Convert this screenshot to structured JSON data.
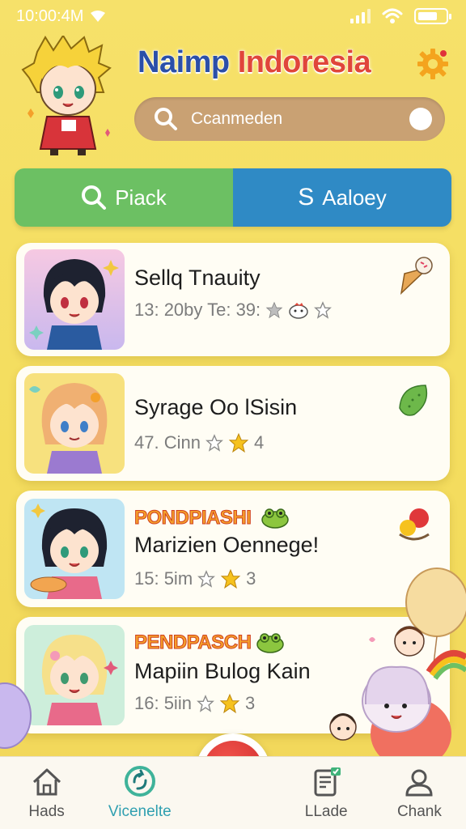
{
  "status_bar": {
    "time": "10:00:4M"
  },
  "header": {
    "title_part1": "Naimp ",
    "title_part2": "Indoresia",
    "search": {
      "value": "Ccanmeden"
    }
  },
  "segments": {
    "left_label": "Piack",
    "right_label": "Aaloey",
    "right_glyph": "S"
  },
  "cards": [
    {
      "title": "Sellq Tnauity",
      "meta": "13: 20by Te: 39:"
    },
    {
      "title": "Syrage Oo lSisin",
      "meta": "47. Cinn",
      "meta_suffix": "4"
    },
    {
      "tag": "PONDPIASHI",
      "title": "Marizien Oennege!",
      "meta": "15: 5im",
      "meta_suffix": "3"
    },
    {
      "tag": "PENDPASCH",
      "title": "Mapiin Bulog Kain",
      "meta": "16: 5iin",
      "meta_suffix": "3"
    }
  ],
  "bottom_nav": [
    {
      "label": "Hads",
      "icon": "home-icon"
    },
    {
      "label": "Vicenelte",
      "icon": "refresh-icon",
      "active": true
    },
    {
      "label": "LLade",
      "icon": "document-icon"
    },
    {
      "label": "Chank",
      "icon": "user-icon"
    }
  ],
  "colors": {
    "accent_green": "#6cc063",
    "accent_blue": "#2f8ac5",
    "active_nav": "#2f9fb0",
    "background": "#f4dd5e"
  }
}
